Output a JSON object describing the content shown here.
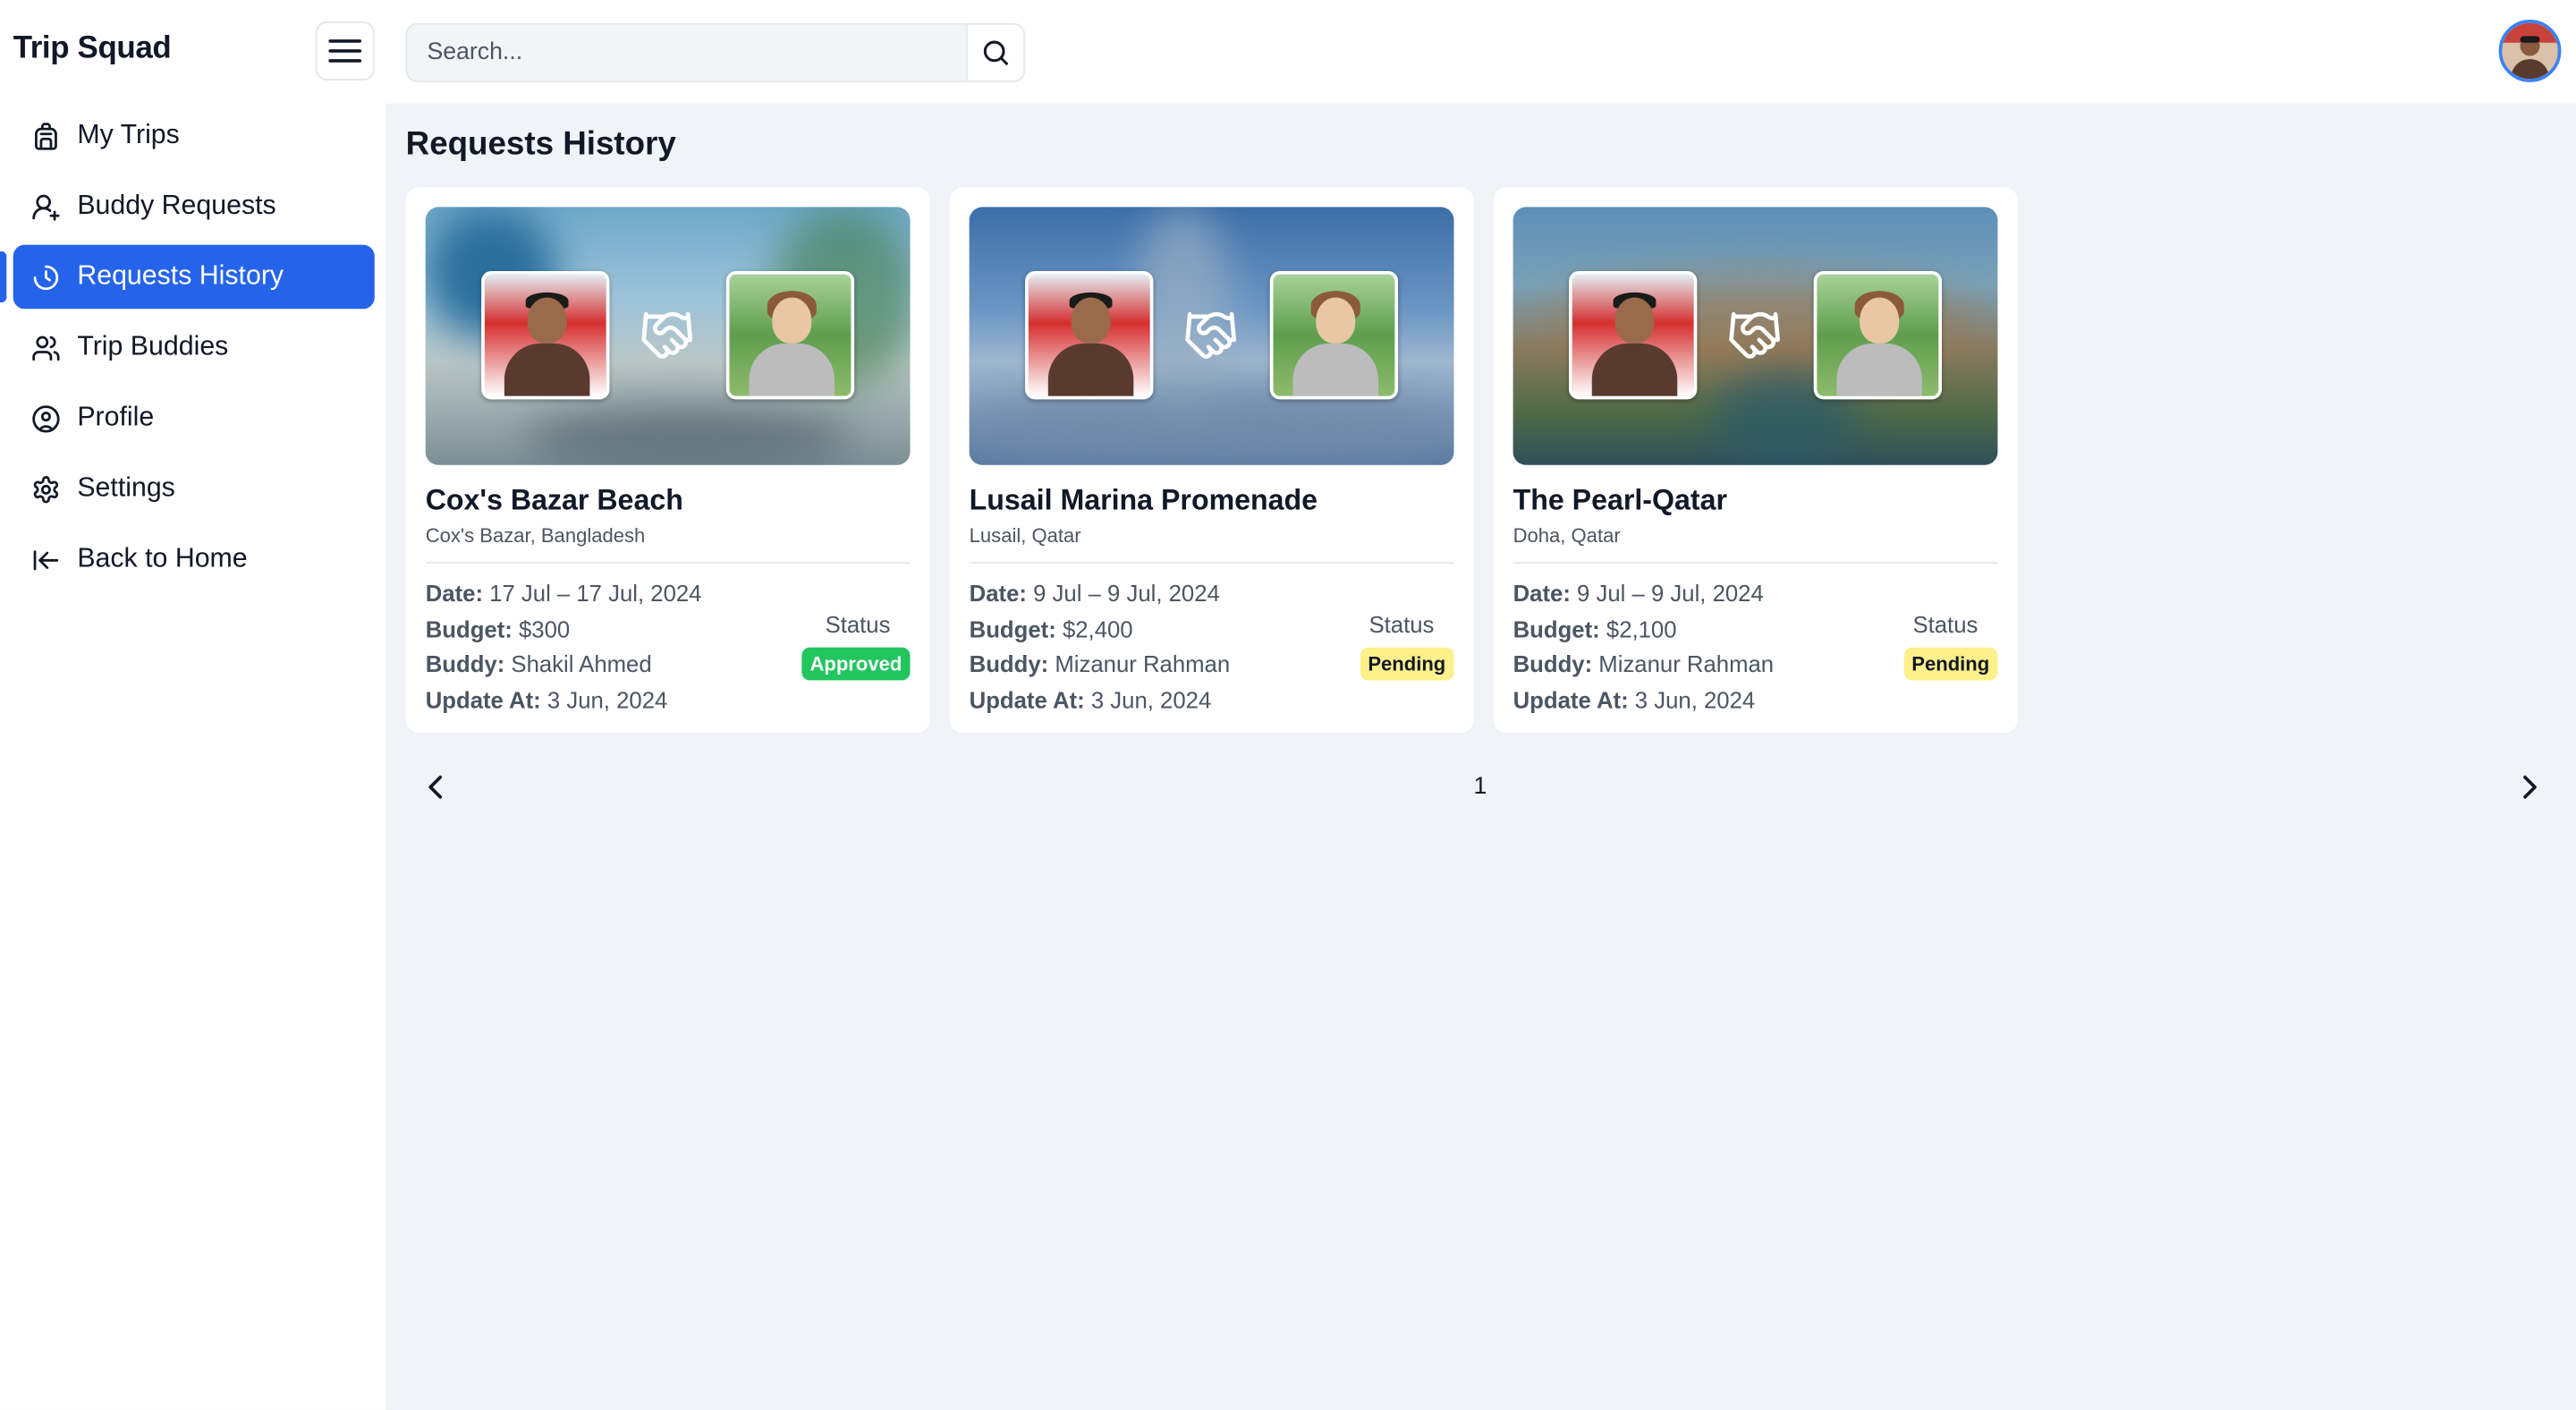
{
  "app": {
    "brand": "Trip Squad"
  },
  "search": {
    "placeholder": "Search..."
  },
  "sidebar": {
    "items": [
      {
        "label": "My Trips",
        "icon": "backpack-icon"
      },
      {
        "label": "Buddy Requests",
        "icon": "user-plus-icon"
      },
      {
        "label": "Requests History",
        "icon": "history-icon",
        "active": true
      },
      {
        "label": "Trip Buddies",
        "icon": "users-icon"
      },
      {
        "label": "Profile",
        "icon": "user-circle-icon"
      },
      {
        "label": "Settings",
        "icon": "gear-icon"
      },
      {
        "label": "Back to Home",
        "icon": "arrow-left-icon"
      }
    ]
  },
  "page": {
    "title": "Requests History"
  },
  "cards": [
    {
      "title": "Cox's Bazar Beach",
      "location": "Cox's Bazar, Bangladesh",
      "date_label": "Date:",
      "date": "17 Jul – 17 Jul, 2024",
      "budget_label": "Budget:",
      "budget": "$300",
      "buddy_label": "Buddy:",
      "buddy": "Shakil Ahmed",
      "update_label": "Update At:",
      "update": "3 Jun, 2024",
      "status_label": "Status",
      "status": "Approved"
    },
    {
      "title": "Lusail Marina Promenade",
      "location": "Lusail, Qatar",
      "date_label": "Date:",
      "date": "9 Jul – 9 Jul, 2024",
      "budget_label": "Budget:",
      "budget": "$2,400",
      "buddy_label": "Buddy:",
      "buddy": "Mizanur Rahman",
      "update_label": "Update At:",
      "update": "3 Jun, 2024",
      "status_label": "Status",
      "status": "Pending"
    },
    {
      "title": "The Pearl-Qatar",
      "location": "Doha, Qatar",
      "date_label": "Date:",
      "date": "9 Jul – 9 Jul, 2024",
      "budget_label": "Budget:",
      "budget": "$2,100",
      "buddy_label": "Buddy:",
      "buddy": "Mizanur Rahman",
      "update_label": "Update At:",
      "update": "3 Jun, 2024",
      "status_label": "Status",
      "status": "Pending"
    }
  ],
  "pagination": {
    "current": "1"
  },
  "colors": {
    "accent": "#2563eb",
    "approved": "#22c55e",
    "pending": "#fef08a",
    "background": "#f0f3f8"
  }
}
